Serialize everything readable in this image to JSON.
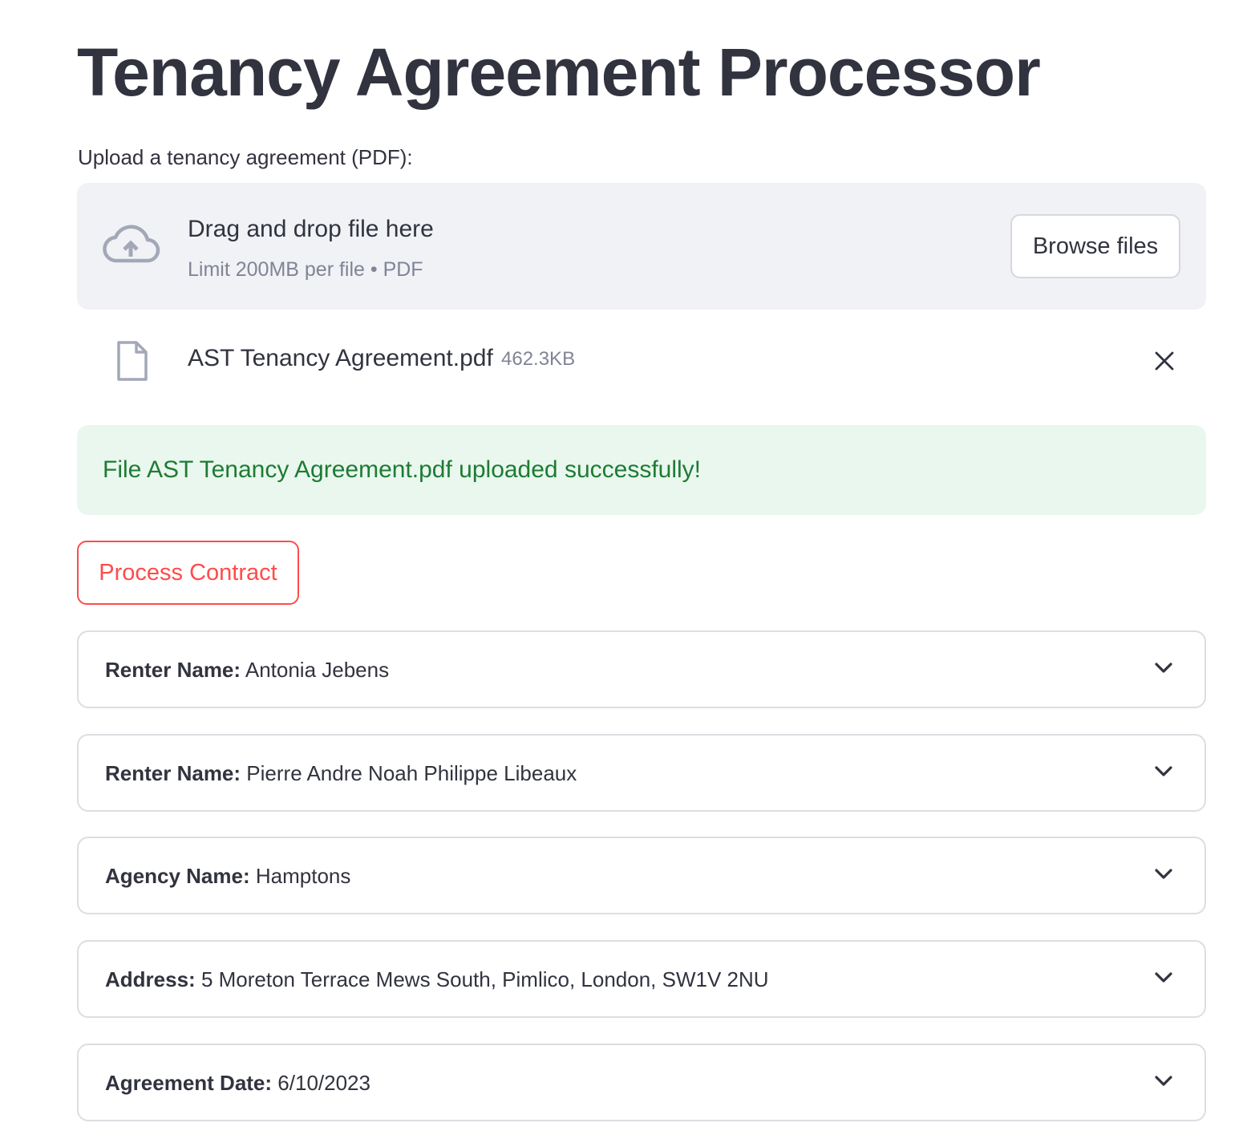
{
  "app": {
    "title": "Tenancy Agreement Processor"
  },
  "uploader": {
    "label": "Upload a tenancy agreement (PDF):",
    "drop_text": "Drag and drop file here",
    "limit_text": "Limit 200MB per file • PDF",
    "browse_label": "Browse files",
    "icon": "cloud-upload-icon"
  },
  "uploaded_file": {
    "name": "AST Tenancy Agreement.pdf",
    "size": "462.3KB",
    "icon": "file-icon",
    "remove_icon": "close-icon"
  },
  "alert": {
    "message": "File AST Tenancy Agreement.pdf uploaded successfully!"
  },
  "process_button": {
    "label": "Process Contract"
  },
  "results": [
    {
      "label": "Renter Name:",
      "value": "Antonia Jebens"
    },
    {
      "label": "Renter Name:",
      "value": "Pierre Andre Noah Philippe Libeaux"
    },
    {
      "label": "Agency Name:",
      "value": "Hamptons"
    },
    {
      "label": "Address:",
      "value": "5 Moreton Terrace Mews South, Pimlico, London, SW1V 2NU"
    },
    {
      "label": "Agreement Date:",
      "value": "6/10/2023"
    }
  ],
  "colors": {
    "text": "#31333f",
    "muted": "#808495",
    "dropzone_bg": "#f0f2f6",
    "success_bg": "#e9f7ee",
    "success_text": "#1e7b34",
    "accent": "#ff4b4b"
  }
}
